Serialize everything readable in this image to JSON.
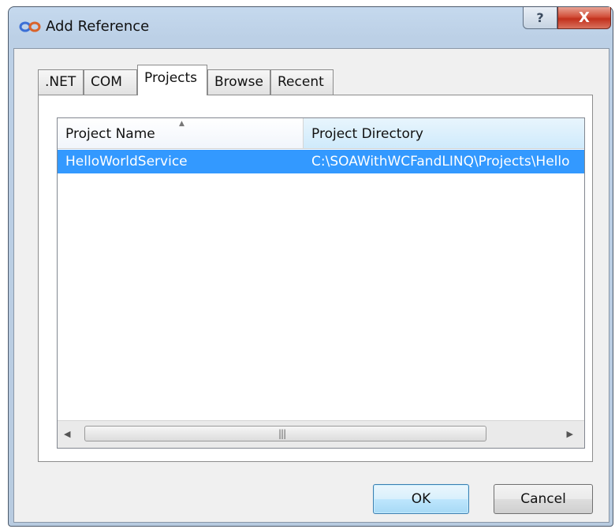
{
  "window": {
    "title": "Add Reference",
    "help_glyph": "?",
    "close_glyph": "X"
  },
  "tabs": [
    {
      "label": ".NET",
      "active": false
    },
    {
      "label": "COM",
      "active": false
    },
    {
      "label": "Projects",
      "active": true
    },
    {
      "label": "Browse",
      "active": false
    },
    {
      "label": "Recent",
      "active": false
    }
  ],
  "list": {
    "columns": [
      "Project Name",
      "Project Directory"
    ],
    "sorted_column": "Project Name",
    "rows": [
      {
        "name": "HelloWorldService",
        "directory": "C:\\SOAWithWCFandLINQ\\Projects\\Hello",
        "selected": true
      }
    ]
  },
  "buttons": {
    "ok": "OK",
    "cancel": "Cancel"
  },
  "colors": {
    "selection": "#3399ff",
    "sorted_header": "#cfeafb",
    "close_button": "#c2301c"
  }
}
